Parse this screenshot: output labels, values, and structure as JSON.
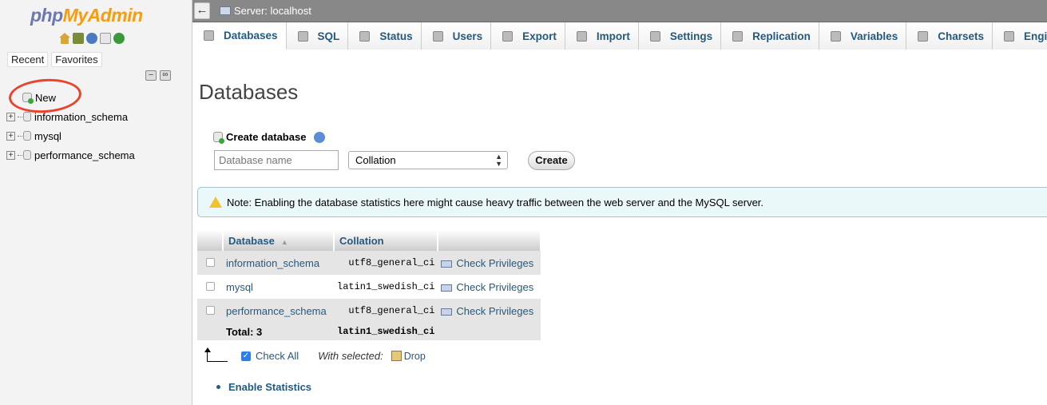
{
  "navigation": {
    "logo_php": "php",
    "logo_myadmin": "MyAdmin",
    "recent_label": "Recent",
    "favorites_label": "Favorites",
    "tree": [
      {
        "label": "New"
      },
      {
        "label": "information_schema"
      },
      {
        "label": "mysql"
      },
      {
        "label": "performance_schema"
      }
    ]
  },
  "topbar": {
    "back_label": "←",
    "server_label": "Server: localhost"
  },
  "tabs": [
    {
      "label": "Databases",
      "icon": "database-icon"
    },
    {
      "label": "SQL",
      "icon": "sql-icon"
    },
    {
      "label": "Status",
      "icon": "status-icon"
    },
    {
      "label": "Users",
      "icon": "users-icon"
    },
    {
      "label": "Export",
      "icon": "export-icon"
    },
    {
      "label": "Import",
      "icon": "import-icon"
    },
    {
      "label": "Settings",
      "icon": "wrench-icon"
    },
    {
      "label": "Replication",
      "icon": "replication-icon"
    },
    {
      "label": "Variables",
      "icon": "variables-icon"
    },
    {
      "label": "Charsets",
      "icon": "charsets-icon"
    },
    {
      "label": "Engines",
      "icon": "engines-icon"
    }
  ],
  "main": {
    "title": "Databases",
    "create_label": "Create database",
    "dbname_placeholder": "Database name",
    "collation_value": "Collation",
    "create_button": "Create",
    "note": "Note: Enabling the database statistics here might cause heavy traffic between the web server and the MySQL server.",
    "table": {
      "headers": [
        "Database",
        "Collation"
      ],
      "rows": [
        {
          "name": "information_schema",
          "collation": "utf8_general_ci",
          "action": "Check Privileges"
        },
        {
          "name": "mysql",
          "collation": "latin1_swedish_ci",
          "action": "Check Privileges"
        },
        {
          "name": "performance_schema",
          "collation": "utf8_general_ci",
          "action": "Check Privileges"
        }
      ],
      "total_label": "Total: 3",
      "total_collation": "latin1_swedish_ci"
    },
    "check_all": "Check All",
    "with_selected": "With selected:",
    "drop": "Drop",
    "enable_stats": "Enable Statistics"
  },
  "colors": {
    "link": "#235a81",
    "logo_php": "#6c78af",
    "logo_myadmin": "#f89c0e",
    "highlight_circle": "#e8432c"
  }
}
